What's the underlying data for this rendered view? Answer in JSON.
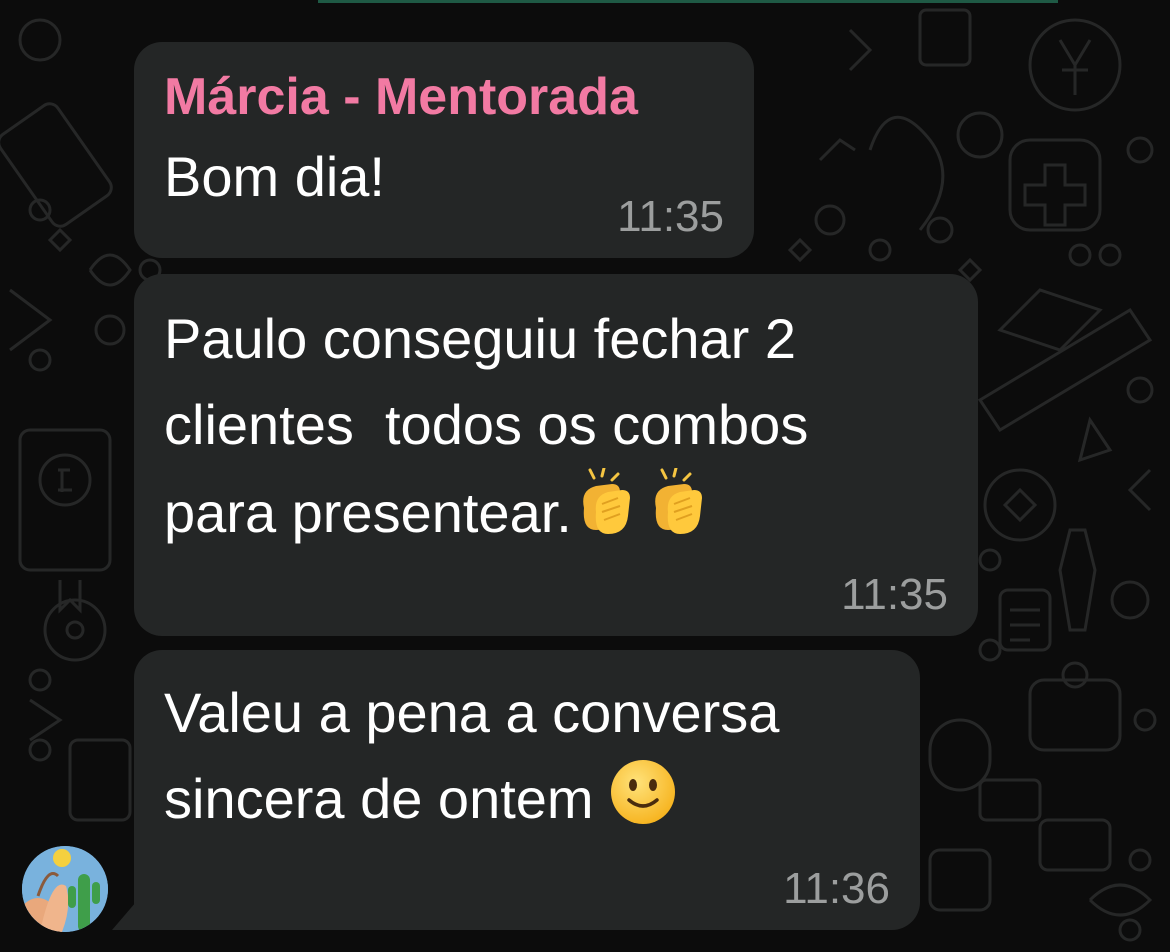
{
  "chat": {
    "messages": [
      {
        "sender": "Márcia - Mentorada",
        "text": "Bom dia!",
        "time": "11:35"
      },
      {
        "text_line1": "Paulo conseguiu fechar 2",
        "text_line2": "clientes  todos os combos",
        "text_line3": "para presentear.",
        "emojis": [
          "clapping-hands",
          "clapping-hands"
        ],
        "time": "11:35"
      },
      {
        "text_line1": "Valeu a pena a conversa",
        "text_line2": "sincera de ontem",
        "emojis": [
          "slightly-smiling-face"
        ],
        "time": "11:36"
      }
    ]
  },
  "colors": {
    "bubble_bg": "#242626",
    "sender_name": "#f27aa3",
    "timestamp": "#9c9e9e",
    "wallpaper": "#0c0c0c"
  }
}
